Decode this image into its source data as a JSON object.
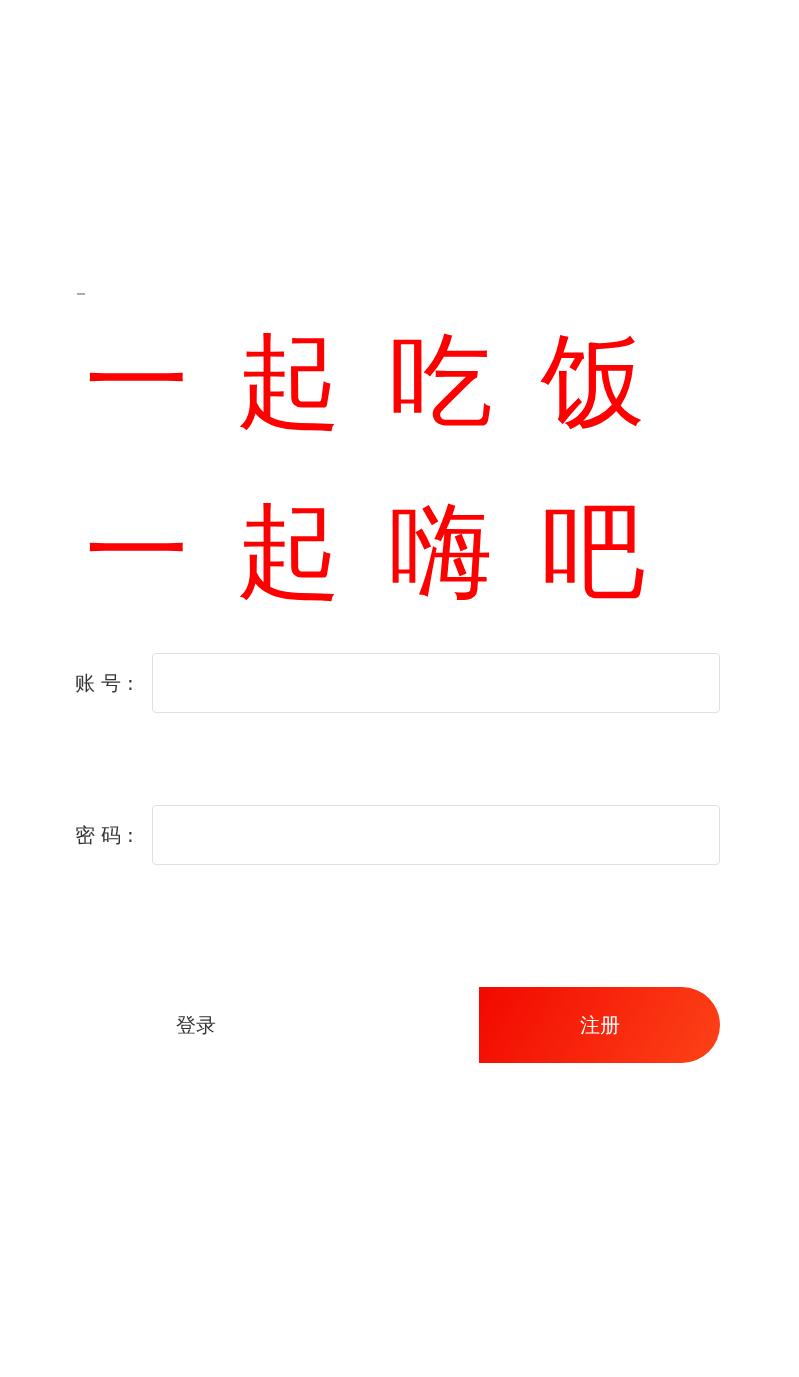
{
  "slogan": [
    "一起吃饭",
    "一起嗨吧"
  ],
  "fields": [
    {
      "label": "账号:"
    },
    {
      "label": "密码:"
    }
  ],
  "buttons": [
    {
      "label": "登录",
      "kind": "plain"
    },
    {
      "label": "注册",
      "kind": "primary"
    }
  ]
}
